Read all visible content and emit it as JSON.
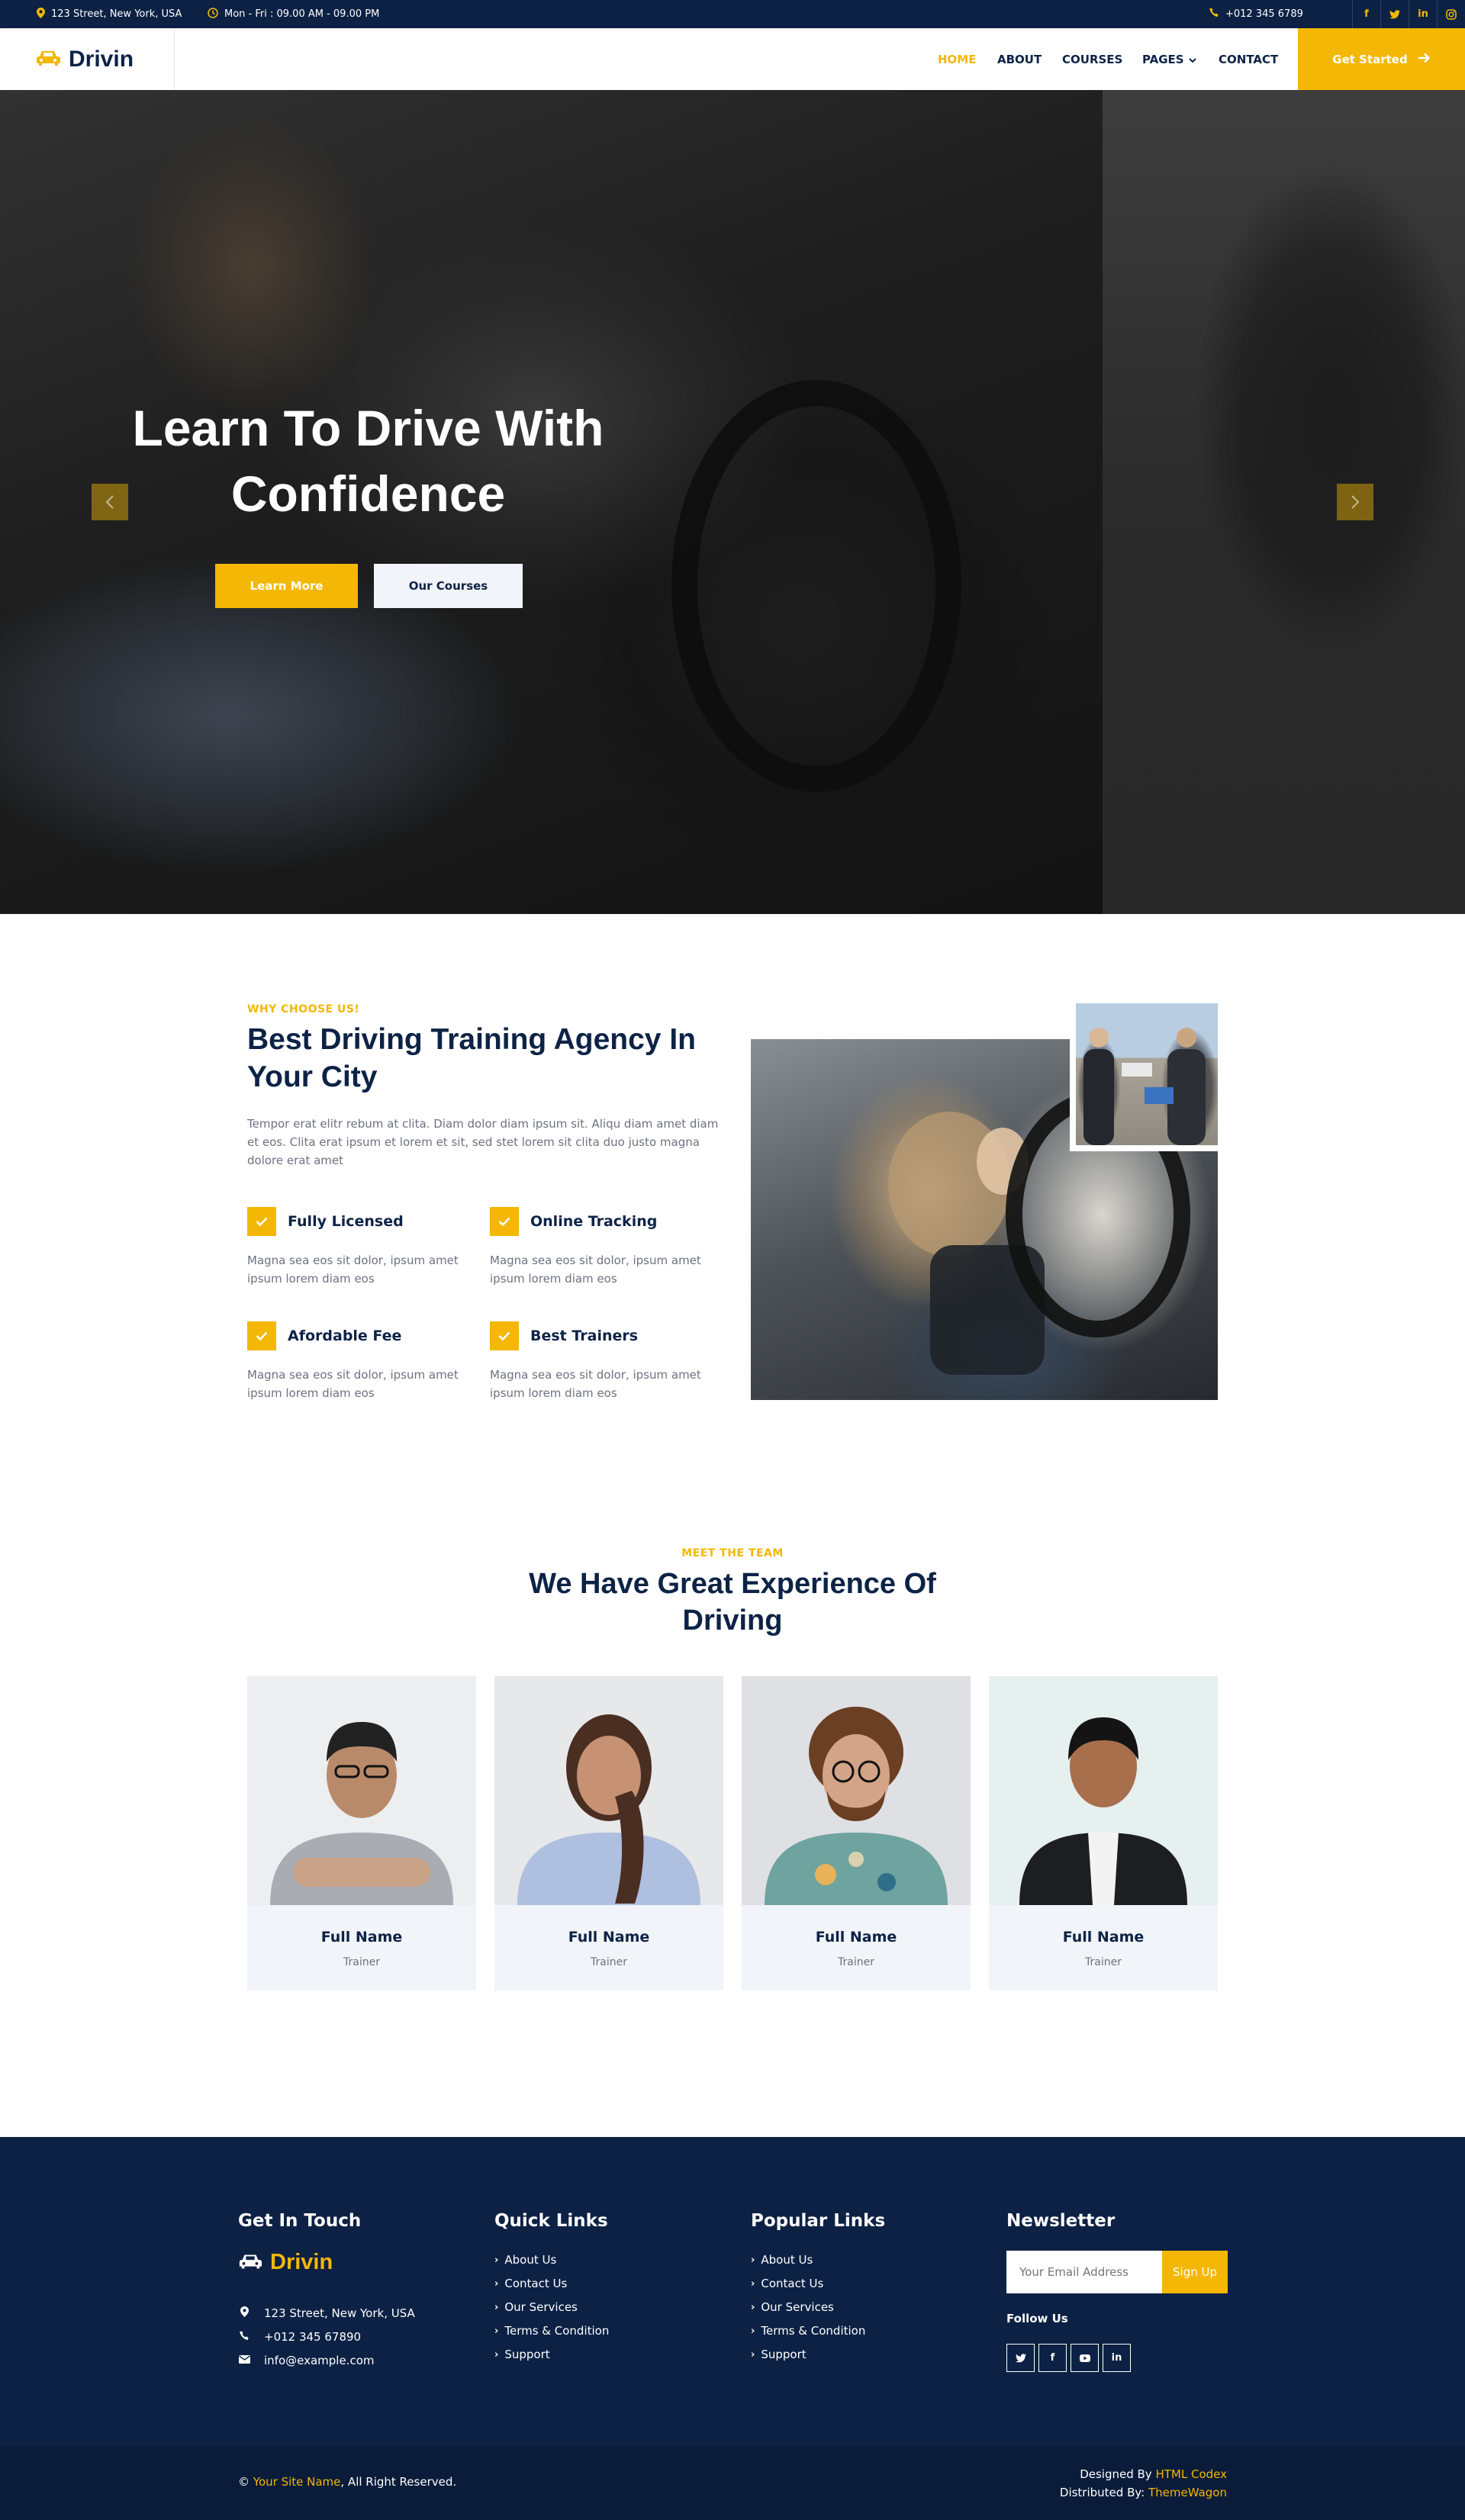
{
  "topbar": {
    "address": "123 Street, New York, USA",
    "hours": "Mon - Fri : 09.00 AM - 09.00 PM",
    "phone": "+012 345 6789",
    "socials": [
      "f",
      "t",
      "in",
      "ig"
    ]
  },
  "navbar": {
    "brand": "Drivin",
    "menu": [
      "HOME",
      "ABOUT",
      "COURSES",
      "PAGES",
      "CONTACT"
    ],
    "active": "HOME",
    "cta": "Get Started"
  },
  "hero": {
    "title_line1": "Learn To Drive With",
    "title_line2": "Confidence",
    "btn_primary": "Learn More",
    "btn_secondary": "Our Courses"
  },
  "why": {
    "eyebrow": "WHY CHOOSE US!",
    "title": "Best Driving Training Agency In Your City",
    "text": "Tempor erat elitr rebum at clita. Diam dolor diam ipsum sit. Aliqu diam amet diam et eos. Clita erat ipsum et lorem et sit, sed stet lorem sit clita duo justo magna dolore erat amet",
    "features": [
      {
        "title": "Fully Licensed",
        "desc": "Magna sea eos sit dolor, ipsum amet ipsum lorem diam eos"
      },
      {
        "title": "Online Tracking",
        "desc": "Magna sea eos sit dolor, ipsum amet ipsum lorem diam eos"
      },
      {
        "title": "Afordable Fee",
        "desc": "Magna sea eos sit dolor, ipsum amet ipsum lorem diam eos"
      },
      {
        "title": "Best Trainers",
        "desc": "Magna sea eos sit dolor, ipsum amet ipsum lorem diam eos"
      }
    ]
  },
  "team": {
    "eyebrow": "MEET THE TEAM",
    "title": "We Have Great Experience Of Driving",
    "members": [
      {
        "name": "Full Name",
        "role": "Trainer"
      },
      {
        "name": "Full Name",
        "role": "Trainer"
      },
      {
        "name": "Full Name",
        "role": "Trainer"
      },
      {
        "name": "Full Name",
        "role": "Trainer"
      }
    ]
  },
  "footer": {
    "touch": {
      "heading": "Get In Touch",
      "brand": "Drivin",
      "address": "123 Street, New York, USA",
      "phone": "+012 345 67890",
      "email": "info@example.com"
    },
    "quick": {
      "heading": "Quick Links",
      "links": [
        "About Us",
        "Contact Us",
        "Our Services",
        "Terms & Condition",
        "Support"
      ]
    },
    "popular": {
      "heading": "Popular Links",
      "links": [
        "About Us",
        "Contact Us",
        "Our Services",
        "Terms & Condition",
        "Support"
      ]
    },
    "newsletter": {
      "heading": "Newsletter",
      "placeholder": "Your Email Address",
      "button": "Sign Up",
      "follow": "Follow Us",
      "socials": [
        "t",
        "f",
        "yt",
        "in"
      ]
    }
  },
  "copyright": {
    "prefix": "©",
    "site_name": "Your Site Name",
    "suffix": ", All Right Reserved.",
    "designed_label": "Designed By",
    "designed_by": "HTML Codex",
    "distributed_label": "Distributed By:",
    "distributed_by": "ThemeWagon"
  },
  "colors": {
    "accent": "#f4b705",
    "navy": "#0c2144",
    "light": "#f1f4f8"
  }
}
